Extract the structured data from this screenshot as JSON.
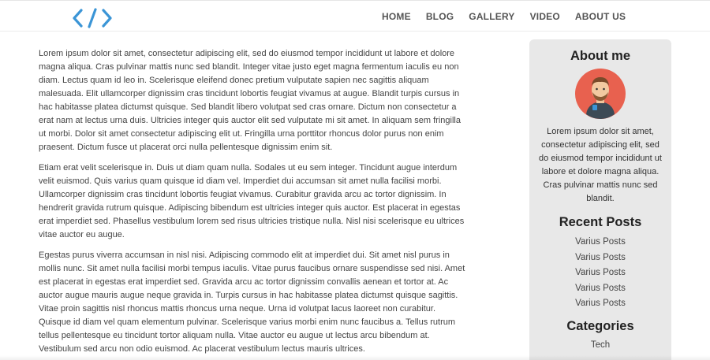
{
  "header": {
    "logo_icon": "code-brackets-icon",
    "accent_color": "#3b95d6",
    "nav": [
      "HOME",
      "BLOG",
      "GALLERY",
      "VIDEO",
      "ABOUT US"
    ]
  },
  "main": {
    "paragraphs": [
      "Lorem ipsum dolor sit amet, consectetur adipiscing elit, sed do eiusmod tempor incididunt ut labore et dolore magna aliqua. Cras pulvinar mattis nunc sed blandit. Integer vitae justo eget magna fermentum iaculis eu non diam. Lectus quam id leo in. Scelerisque eleifend donec pretium vulputate sapien nec sagittis aliquam malesuada. Elit ullamcorper dignissim cras tincidunt lobortis feugiat vivamus at augue. Blandit turpis cursus in hac habitasse platea dictumst quisque. Sed blandit libero volutpat sed cras ornare. Dictum non consectetur a erat nam at lectus urna duis. Ultricies integer quis auctor elit sed vulputate mi sit amet. In aliquam sem fringilla ut morbi. Dolor sit amet consectetur adipiscing elit ut. Fringilla urna porttitor rhoncus dolor purus non enim praesent. Dictum fusce ut placerat orci nulla pellentesque dignissim enim sit.",
      "Etiam erat velit scelerisque in. Duis ut diam quam nulla. Sodales ut eu sem integer. Tincidunt augue interdum velit euismod. Quis varius quam quisque id diam vel. Imperdiet dui accumsan sit amet nulla facilisi morbi. Ullamcorper dignissim cras tincidunt lobortis feugiat vivamus. Curabitur gravida arcu ac tortor dignissim. In hendrerit gravida rutrum quisque. Adipiscing bibendum est ultricies integer quis auctor. Est placerat in egestas erat imperdiet sed. Phasellus vestibulum lorem sed risus ultricies tristique nulla. Nisl nisi scelerisque eu ultrices vitae auctor eu augue.",
      "Egestas purus viverra accumsan in nisl nisi. Adipiscing commodo elit at imperdiet dui. Sit amet nisl purus in mollis nunc. Sit amet nulla facilisi morbi tempus iaculis. Vitae purus faucibus ornare suspendisse sed nisi. Amet est placerat in egestas erat imperdiet sed. Gravida arcu ac tortor dignissim convallis aenean et tortor at. Ac auctor augue mauris augue neque gravida in. Turpis cursus in hac habitasse platea dictumst quisque sagittis. Vitae proin sagittis nisl rhoncus mattis rhoncus urna neque. Urna id volutpat lacus laoreet non curabitur. Quisque id diam vel quam elementum pulvinar. Scelerisque varius morbi enim nunc faucibus a. Tellus rutrum tellus pellentesque eu tincidunt tortor aliquam nulla. Vitae auctor eu augue ut lectus arcu bibendum at. Vestibulum sed arcu non odio euismod. Ac placerat vestibulum lectus mauris ultrices."
    ]
  },
  "sidebar": {
    "about_title": "About me",
    "about_text": "Lorem ipsum dolor sit amet, consectetur adipiscing elit, sed do eiusmod tempor incididunt ut labore et dolore magna aliqua. Cras pulvinar mattis nunc sed blandit.",
    "recent_title": "Recent Posts",
    "recent_posts": [
      "Varius Posts",
      "Varius Posts",
      "Varius Posts",
      "Varius Posts",
      "Varius Posts"
    ],
    "categories_title": "Categories",
    "categories": [
      "Tech"
    ],
    "avatar_icon": "user-avatar-icon",
    "avatar_bg_color": "#e8614f"
  }
}
